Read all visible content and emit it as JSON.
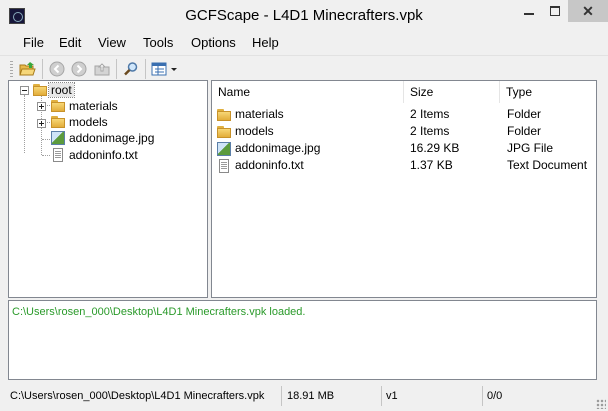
{
  "window": {
    "title": "GCFScape - L4D1 Minecrafters.vpk",
    "app_icon": "gcfscape-app-icon",
    "controls": {
      "minimize": "minimize-icon",
      "maximize": "maximize-icon",
      "close": "✕"
    }
  },
  "menu": [
    "File",
    "Edit",
    "View",
    "Tools",
    "Options",
    "Help"
  ],
  "toolbar": {
    "buttons": [
      "open-folder-icon",
      "back-icon",
      "forward-icon",
      "up-icon",
      "find-icon",
      "view-mode-icon"
    ]
  },
  "tree": {
    "root": "root",
    "items": [
      {
        "label": "materials",
        "icon": "folder-icon",
        "expandable": true
      },
      {
        "label": "models",
        "icon": "folder-icon",
        "expandable": true
      },
      {
        "label": "addonimage.jpg",
        "icon": "image-file-icon",
        "expandable": false
      },
      {
        "label": "addoninfo.txt",
        "icon": "text-file-icon",
        "expandable": false
      }
    ]
  },
  "list": {
    "columns": [
      "Name",
      "Size",
      "Type"
    ],
    "rows": [
      {
        "name": "materials",
        "size": "2 Items",
        "type": "Folder",
        "icon": "folder-icon"
      },
      {
        "name": "models",
        "size": "2 Items",
        "type": "Folder",
        "icon": "folder-icon"
      },
      {
        "name": "addonimage.jpg",
        "size": "16.29 KB",
        "type": "JPG File",
        "icon": "image-file-icon"
      },
      {
        "name": "addoninfo.txt",
        "size": "1.37 KB",
        "type": "Text Document",
        "icon": "text-file-icon"
      }
    ]
  },
  "console": {
    "text": "C:\\Users\\rosen_000\\Desktop\\L4D1 Minecrafters.vpk loaded.",
    "color": "#2a9a2a"
  },
  "status": {
    "path": "C:\\Users\\rosen_000\\Desktop\\L4D1 Minecrafters.vpk",
    "size": "18.91 MB",
    "version": "v1",
    "count": "0/0"
  }
}
